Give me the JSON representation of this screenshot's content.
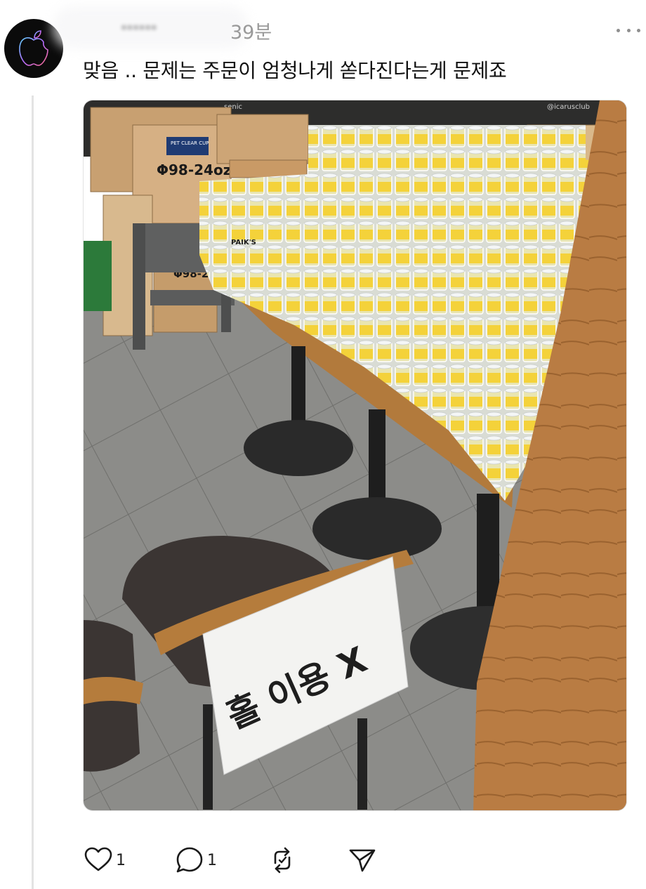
{
  "post": {
    "username": "ᐩᐩᐩᐩᐩᐩ",
    "timestamp": "39분",
    "text": "맞음 .. 문제는 주문이 엄청나게 쏟다진다는게 문제죠",
    "avatar_icon": "apple-logo-icon",
    "more_icon": "ellipsis-icon"
  },
  "photo": {
    "box_label_1": "PET CLEAR CUP",
    "box_label_2": "Φ98-24oz",
    "box_label_3": "Φ98-2",
    "cup_label": "PAIK'S",
    "sign_text": "홀 이용 X"
  },
  "actions": {
    "like_count": "1",
    "reply_count": "1",
    "like_icon": "heart-icon",
    "reply_icon": "comment-icon",
    "repost_icon": "repost-icon",
    "share_icon": "send-icon"
  }
}
